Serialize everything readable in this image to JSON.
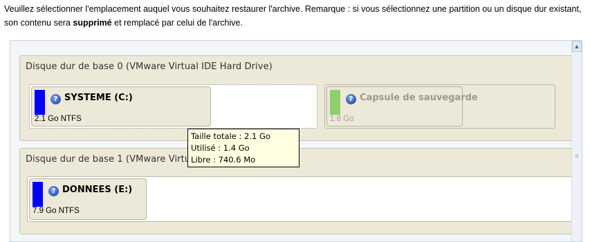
{
  "instructions": {
    "part1": "Veuillez sélectionner l'emplacement auquel vous souhaitez restaurer l'archive. Remarque : si vous sélectionnez une partition ou un disque dur existant, son contenu sera ",
    "bold": "supprimé",
    "part2": " et remplacé par celui de l'archive."
  },
  "disks": [
    {
      "title": "Disque dur de base 0 (VMware Virtual IDE Hard Drive)",
      "partitions": [
        {
          "name": "SYSTEME (C:)",
          "info": "2.1 Go NTFS",
          "color": "#0000ff",
          "help_icon": "help-icon"
        },
        {
          "name": "Capsule de sauvegarde",
          "info": "1.8 Go",
          "color": "#8fcf6e",
          "help_icon": "help-icon",
          "disabled": true
        }
      ]
    },
    {
      "title": "Disque dur de base 1 (VMware Virtual IDE Hard Drive)",
      "partitions": [
        {
          "name": "DONNEES (E:)",
          "info": "7.9 Go NTFS",
          "color": "#0000ff",
          "help_icon": "help-icon"
        }
      ]
    }
  ],
  "tooltip": {
    "total": "Taille totale : 2.1 Go",
    "used": "Utilisé : 1.4 Go",
    "free": "Libre : 740.6 Mo"
  }
}
